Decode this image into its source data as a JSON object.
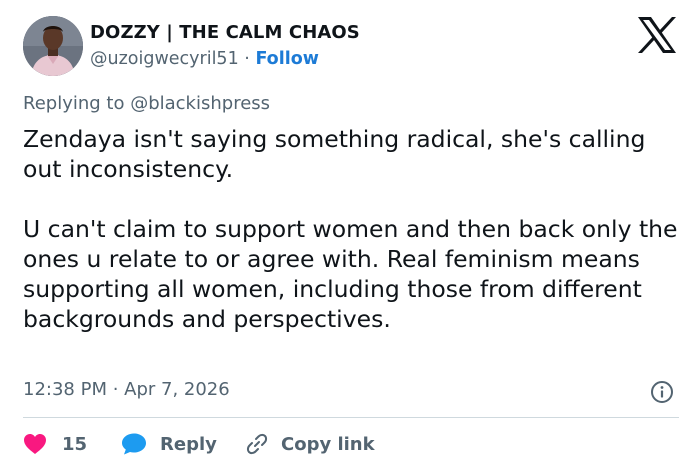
{
  "author": {
    "display_name": "DOZZY | THE CALM CHAOS",
    "handle": "@uzoigwecyril51",
    "separator": "·",
    "follow_label": "Follow"
  },
  "reply_context": {
    "prefix": "Replying to ",
    "mention": "@blackishpress"
  },
  "tweet": {
    "text": "Zendaya isn't saying something radical, she's calling out inconsistency.\n\nU can't claim to support women and then back only the ones u relate to or agree with. Real feminism means supporting all women, including those from different backgrounds and perspectives.",
    "timestamp": "12:38 PM · Apr 7, 2026"
  },
  "actions": {
    "like_count": "15",
    "reply_label": "Reply",
    "copy_link_label": "Copy link"
  },
  "icons": {
    "logo": "x-logo-icon",
    "info": "info-icon",
    "like": "heart-icon",
    "reply": "speech-bubble-icon",
    "copy": "link-icon"
  },
  "colors": {
    "text": "#0f1419",
    "secondary": "#536471",
    "follow": "#1d7bd6",
    "heart": "#f91880",
    "reply_bubble": "#1d9bf0",
    "divider": "#cfd9de"
  }
}
